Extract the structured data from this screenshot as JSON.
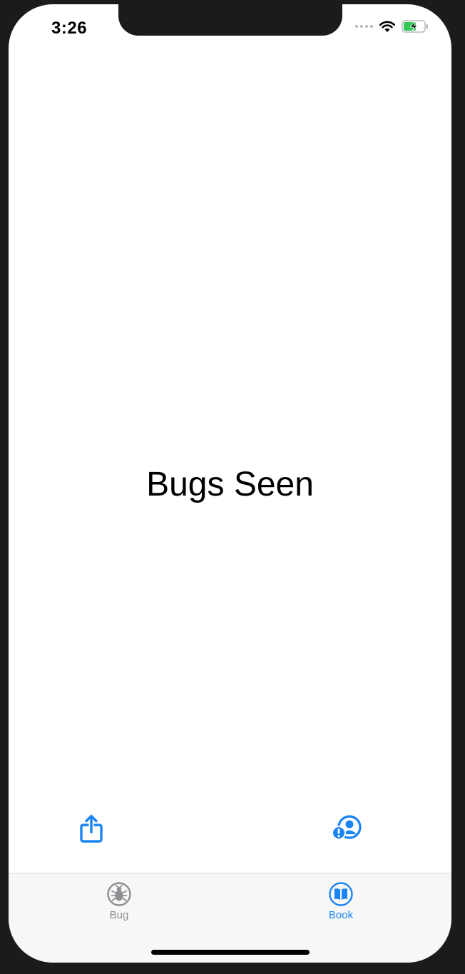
{
  "status_bar": {
    "time": "3:26"
  },
  "main": {
    "title": "Bugs Seen"
  },
  "toolbar": {
    "left_icon": "share-icon",
    "right_icon": "person-report-icon"
  },
  "tab_bar": {
    "items": [
      {
        "label": "Bug",
        "icon": "bug-icon",
        "selected": false
      },
      {
        "label": "Book",
        "icon": "book-icon",
        "selected": true
      }
    ]
  },
  "colors": {
    "accent": "#1a84f5",
    "inactive": "#8e8e93",
    "battery": "#34c759"
  }
}
